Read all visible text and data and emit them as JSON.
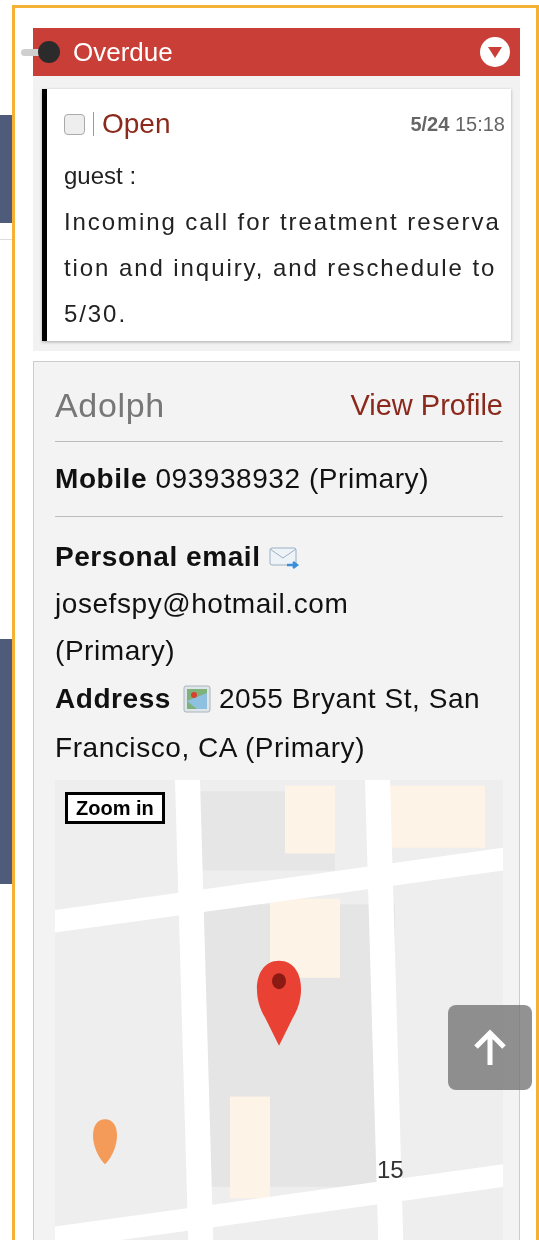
{
  "section": {
    "title": "Overdue"
  },
  "task": {
    "checked": false,
    "status": "Open",
    "date": "5/24",
    "time": "15:18",
    "author": "guest :",
    "note": "Incoming call for treatment reservation and inquiry, and reschedule to 5/30."
  },
  "contact": {
    "name": "Adolph",
    "link": "View Profile",
    "fields": [
      {
        "kind": "phone",
        "label": "Mobile",
        "value": "093938932 (Primary)"
      },
      {
        "kind": "email",
        "label": "Personal email",
        "value": "josefspy@hotmail.com (Primary)"
      },
      {
        "kind": "address",
        "label": "Address",
        "lines": [
          "2055 Bryant St, San",
          "Francisco, CA (Primary)"
        ]
      }
    ]
  },
  "map": {
    "zoom_button": "Zoom in",
    "label": "15"
  }
}
